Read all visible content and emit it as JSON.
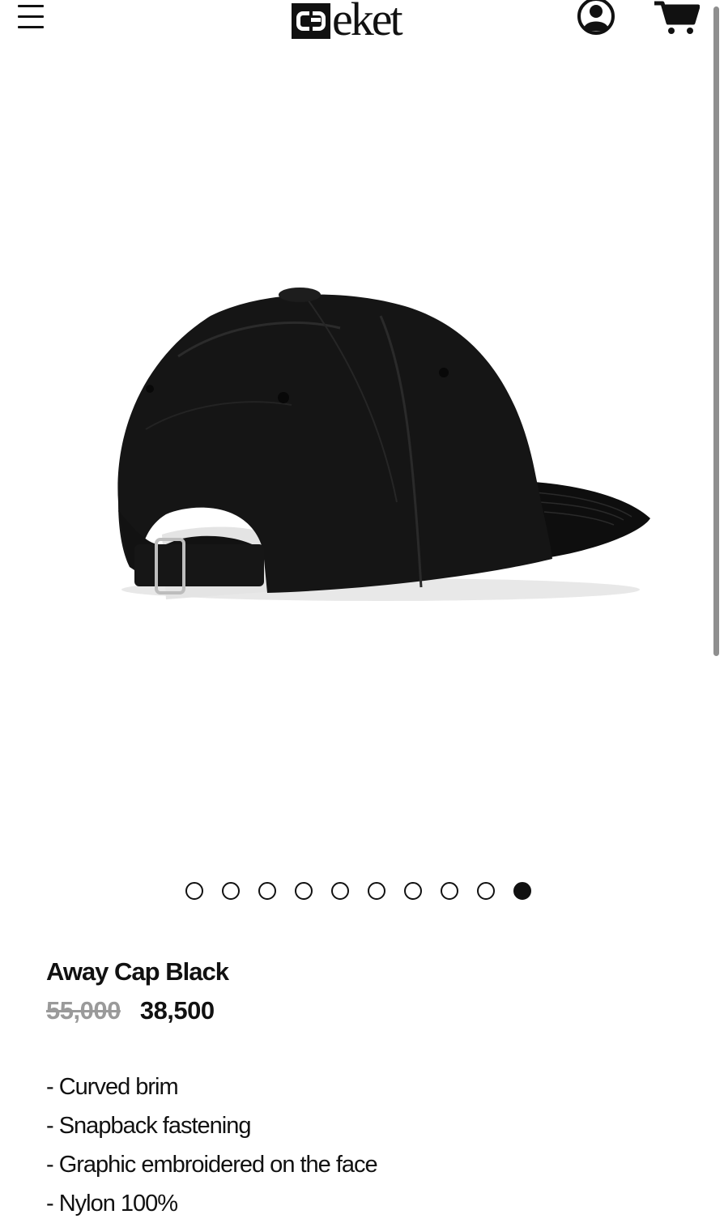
{
  "header": {
    "logo_text": "eket",
    "logo_alt": "cleket"
  },
  "carousel": {
    "total": 10,
    "active_index": 9
  },
  "product": {
    "title": "Away Cap Black",
    "original_price": "55,000",
    "sale_price": "38,500",
    "features": [
      "- Curved brim",
      "- Snapback fastening",
      "- Graphic embroidered on the face",
      "- Nylon 100%"
    ]
  },
  "icons": {
    "menu": "hamburger-icon",
    "account": "account-icon",
    "cart": "cart-icon"
  },
  "colors": {
    "text": "#111111",
    "strike_price": "#9a9a9a",
    "background": "#ffffff"
  }
}
